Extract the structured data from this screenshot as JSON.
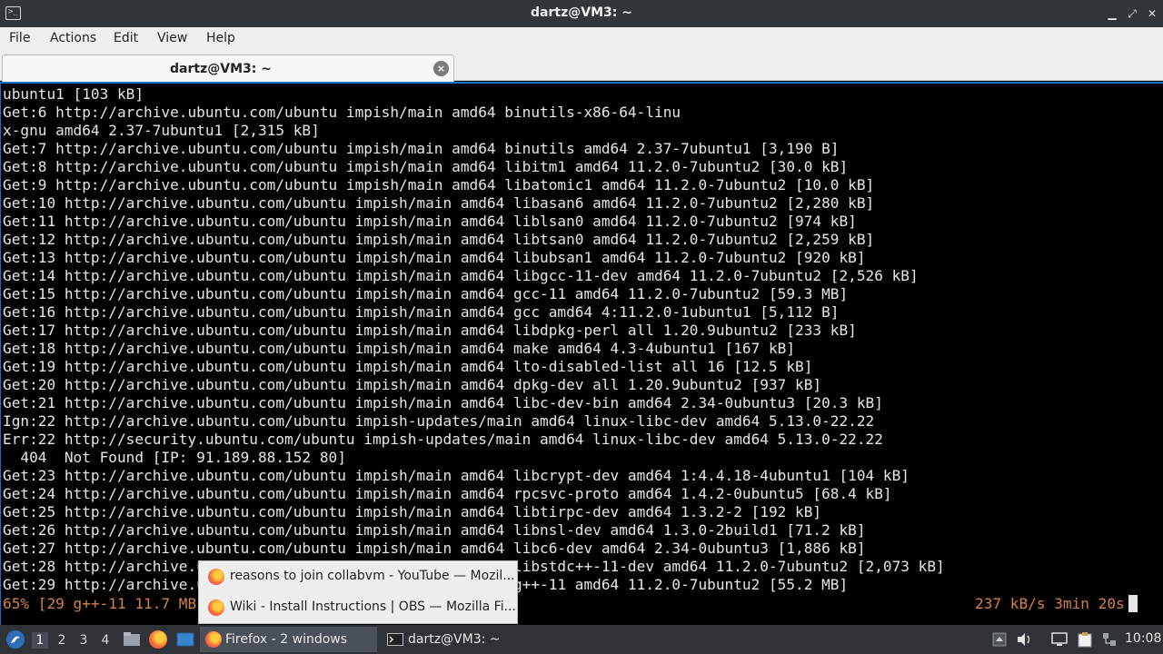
{
  "window": {
    "title": "dartz@VM3: ~",
    "minimize_glyph": "▁",
    "maximize_glyph": "⤢",
    "close_glyph": "✕"
  },
  "menu": {
    "items": [
      "File",
      "Actions",
      "Edit",
      "View",
      "Help"
    ]
  },
  "tabs": [
    {
      "label": "dartz@VM3: ~",
      "close_glyph": "×"
    }
  ],
  "terminal": {
    "lines": [
      "ubuntu1 [103 kB]",
      "Get:6 http://archive.ubuntu.com/ubuntu impish/main amd64 binutils-x86-64-linu",
      "x-gnu amd64 2.37-7ubuntu1 [2,315 kB]",
      "Get:7 http://archive.ubuntu.com/ubuntu impish/main amd64 binutils amd64 2.37-7ubuntu1 [3,190 B]",
      "Get:8 http://archive.ubuntu.com/ubuntu impish/main amd64 libitm1 amd64 11.2.0-7ubuntu2 [30.0 kB]",
      "Get:9 http://archive.ubuntu.com/ubuntu impish/main amd64 libatomic1 amd64 11.2.0-7ubuntu2 [10.0 kB]",
      "Get:10 http://archive.ubuntu.com/ubuntu impish/main amd64 libasan6 amd64 11.2.0-7ubuntu2 [2,280 kB]",
      "Get:11 http://archive.ubuntu.com/ubuntu impish/main amd64 liblsan0 amd64 11.2.0-7ubuntu2 [974 kB]",
      "Get:12 http://archive.ubuntu.com/ubuntu impish/main amd64 libtsan0 amd64 11.2.0-7ubuntu2 [2,259 kB]",
      "Get:13 http://archive.ubuntu.com/ubuntu impish/main amd64 libubsan1 amd64 11.2.0-7ubuntu2 [920 kB]",
      "Get:14 http://archive.ubuntu.com/ubuntu impish/main amd64 libgcc-11-dev amd64 11.2.0-7ubuntu2 [2,526 kB]",
      "Get:15 http://archive.ubuntu.com/ubuntu impish/main amd64 gcc-11 amd64 11.2.0-7ubuntu2 [59.3 MB]",
      "Get:16 http://archive.ubuntu.com/ubuntu impish/main amd64 gcc amd64 4:11.2.0-1ubuntu1 [5,112 B]",
      "Get:17 http://archive.ubuntu.com/ubuntu impish/main amd64 libdpkg-perl all 1.20.9ubuntu2 [233 kB]",
      "Get:18 http://archive.ubuntu.com/ubuntu impish/main amd64 make amd64 4.3-4ubuntu1 [167 kB]",
      "Get:19 http://archive.ubuntu.com/ubuntu impish/main amd64 lto-disabled-list all 16 [12.5 kB]",
      "Get:20 http://archive.ubuntu.com/ubuntu impish/main amd64 dpkg-dev all 1.20.9ubuntu2 [937 kB]",
      "Get:21 http://archive.ubuntu.com/ubuntu impish/main amd64 libc-dev-bin amd64 2.34-0ubuntu3 [20.3 kB]",
      "Ign:22 http://archive.ubuntu.com/ubuntu impish-updates/main amd64 linux-libc-dev amd64 5.13.0-22.22",
      "Err:22 http://security.ubuntu.com/ubuntu impish-updates/main amd64 linux-libc-dev amd64 5.13.0-22.22",
      "  404  Not Found [IP: 91.189.88.152 80]",
      "Get:23 http://archive.ubuntu.com/ubuntu impish/main amd64 libcrypt-dev amd64 1:4.4.18-4ubuntu1 [104 kB]",
      "Get:24 http://archive.ubuntu.com/ubuntu impish/main amd64 rpcsvc-proto amd64 1.4.2-0ubuntu5 [68.4 kB]",
      "Get:25 http://archive.ubuntu.com/ubuntu impish/main amd64 libtirpc-dev amd64 1.3.2-2 [192 kB]",
      "Get:26 http://archive.ubuntu.com/ubuntu impish/main amd64 libnsl-dev amd64 1.3.0-2build1 [71.2 kB]",
      "Get:27 http://archive.ubuntu.com/ubuntu impish/main amd64 libc6-dev amd64 2.34-0ubuntu3 [1,886 kB]",
      "Get:28 http://archive.ubuntu.com/ubuntu impish/main amd64 libstdc++-11-dev amd64 11.2.0-7ubuntu2 [2,073 kB]",
      "Get:29 http://archive.ubuntu.com/ubuntu impish/main amd64 g++-11 amd64 11.2.0-7ubuntu2 [55.2 MB]"
    ],
    "progress_left": "65% [29 g++-11 11.7 MB",
    "progress_right": "237 kB/s 3min 20s"
  },
  "taskbar_popup": {
    "items": [
      "reasons to join collabvm - YouTube — Mozil...",
      "Wiki - Install Instructions | OBS — Mozilla Fi..."
    ]
  },
  "taskbar": {
    "desktops": [
      "1",
      "2",
      "3",
      "4"
    ],
    "active_desktop": "1",
    "tasks": [
      {
        "label": "Firefox - 2 windows",
        "icon": "firefox-icon"
      },
      {
        "label": "dartz@VM3: ~",
        "icon": "terminal-icon"
      }
    ],
    "clock": "10:08"
  },
  "colors": {
    "titlebar": "#31363b",
    "accent": "#1e6fc8",
    "progress_text": "#d6814b",
    "terminal_bg": "#000000",
    "terminal_fg": "#e6e6e6"
  }
}
